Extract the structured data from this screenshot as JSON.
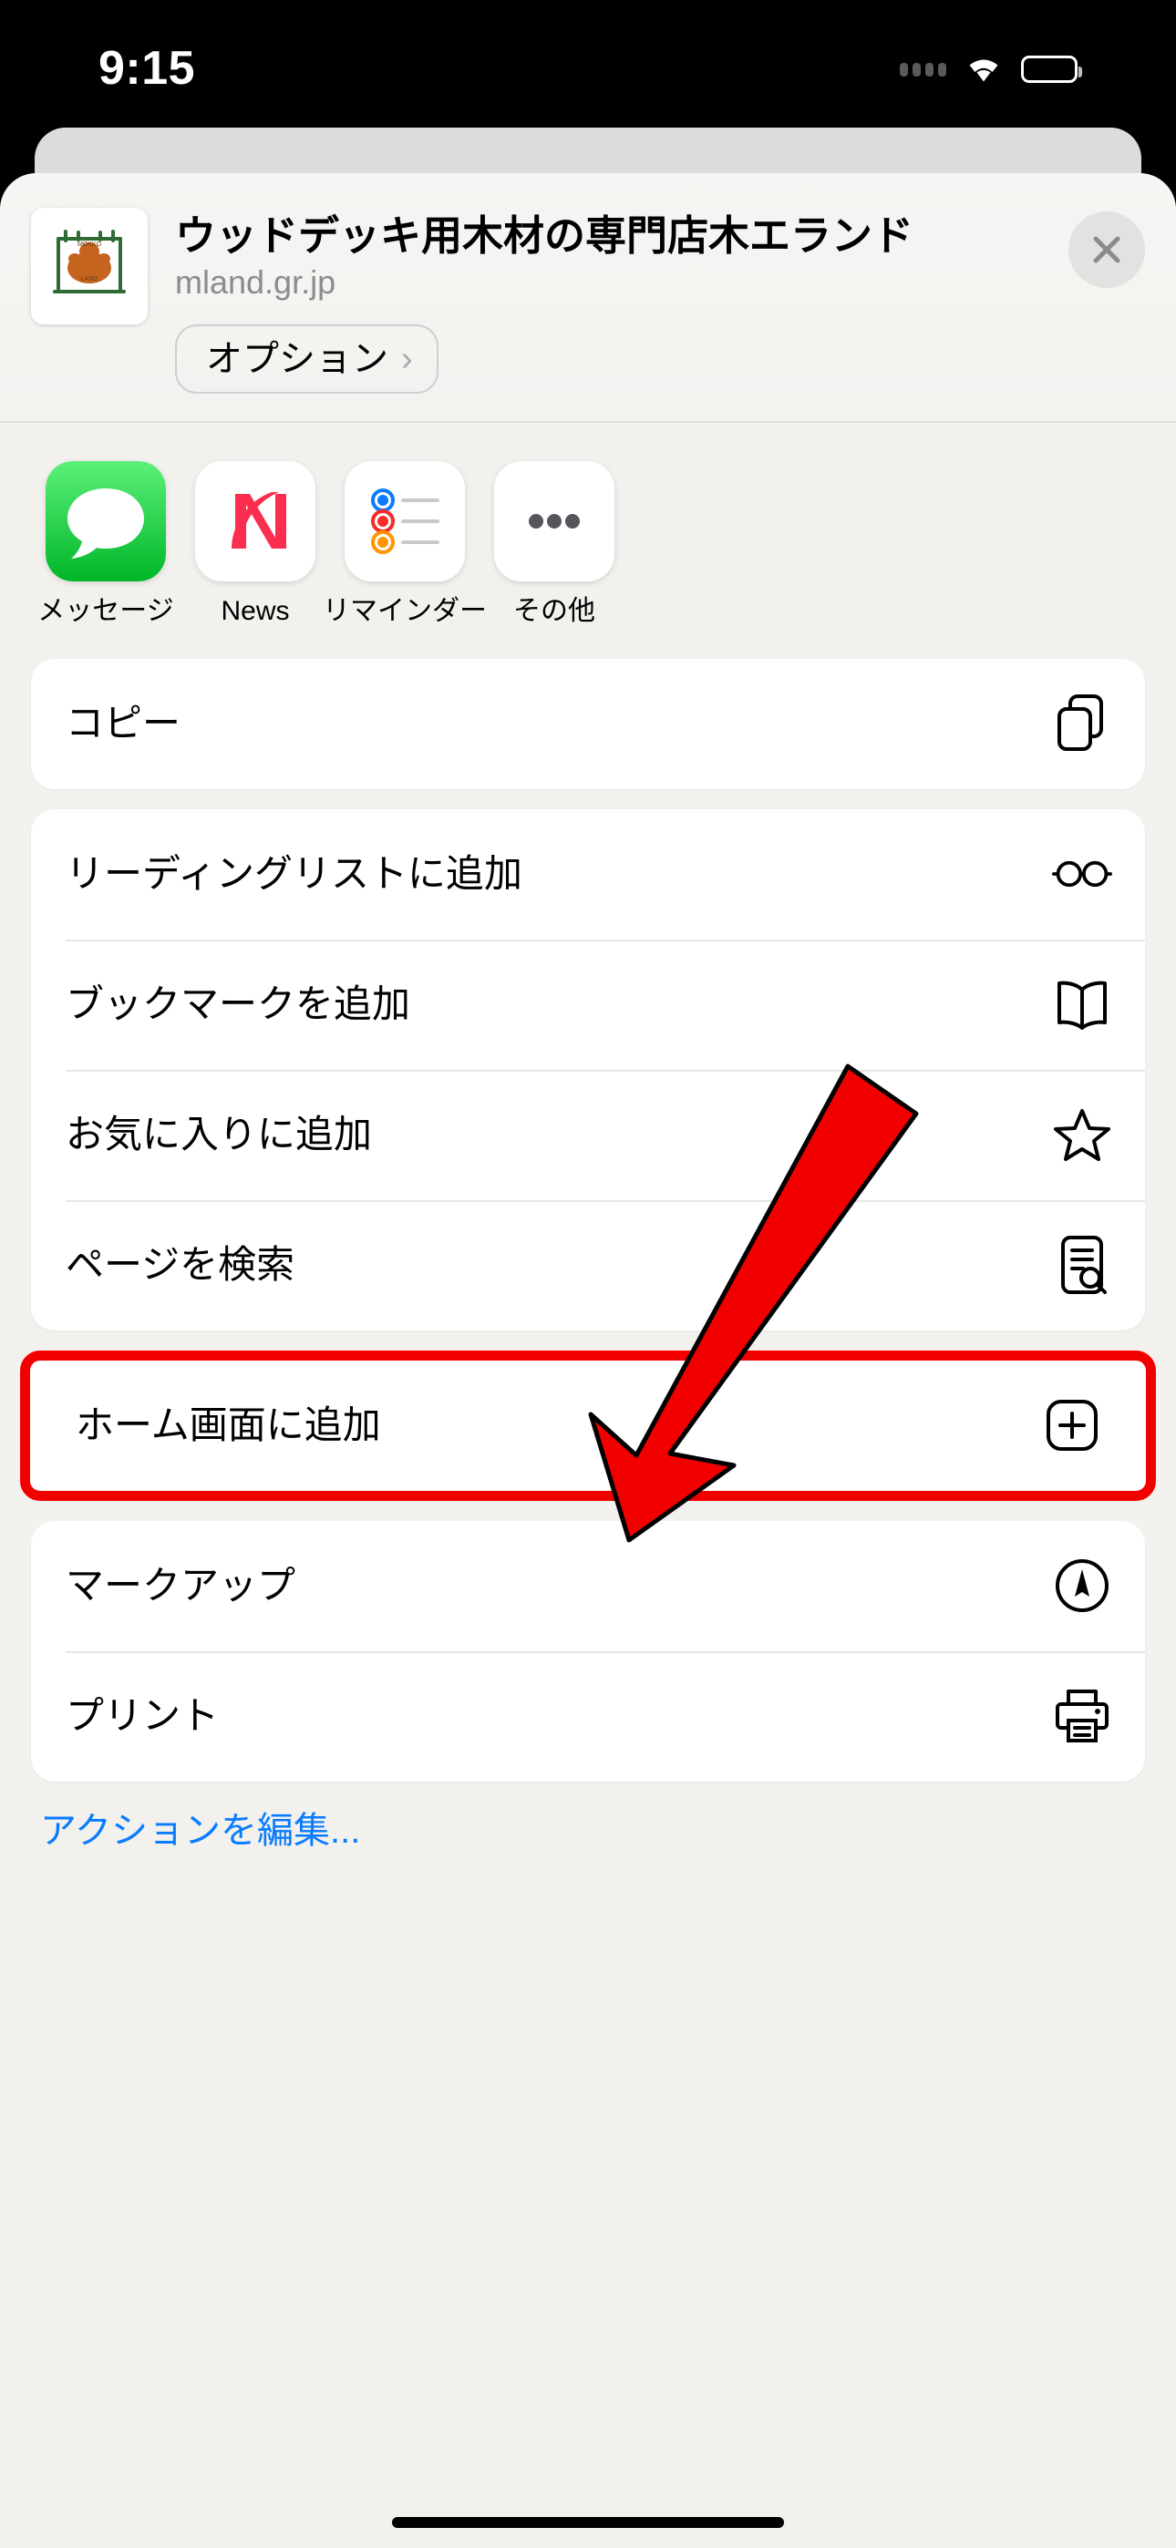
{
  "status_bar": {
    "time": "9:15",
    "signal_icon": "signal-dots-icon",
    "wifi_icon": "wifi-icon",
    "battery_icon": "battery-icon"
  },
  "share_sheet": {
    "header": {
      "thumbnail_name": "site-favicon-thumbnail",
      "title": "ウッドデッキ用木材の専門店木エランド",
      "url": "mland.gr.jp",
      "options_label": "オプション",
      "options_chevron": "›",
      "close_label": "✕"
    },
    "apps": [
      {
        "label": "メッセージ",
        "icon": "messages-icon"
      },
      {
        "label": "News",
        "icon": "news-icon"
      },
      {
        "label": "リマインダー",
        "icon": "reminders-icon"
      },
      {
        "label": "その他",
        "icon": "more-ellipsis-icon"
      }
    ],
    "group_copy": [
      {
        "label": "コピー",
        "icon": "copy-icon"
      }
    ],
    "group_actions_top": [
      {
        "label": "リーディングリストに追加",
        "icon": "glasses-icon"
      },
      {
        "label": "ブックマークを追加",
        "icon": "book-icon"
      },
      {
        "label": "お気に入りに追加",
        "icon": "star-icon"
      },
      {
        "label": "ページを検索",
        "icon": "find-on-page-icon"
      }
    ],
    "highlighted_action": {
      "label": "ホーム画面に追加",
      "icon": "add-to-home-plus-icon"
    },
    "group_actions_bottom": [
      {
        "label": "マークアップ",
        "icon": "markup-pen-icon"
      },
      {
        "label": "プリント",
        "icon": "printer-icon"
      }
    ],
    "edit_actions_label": "アクションを編集...",
    "highlight_color": "#f20000",
    "link_color": "#0a7cff"
  }
}
